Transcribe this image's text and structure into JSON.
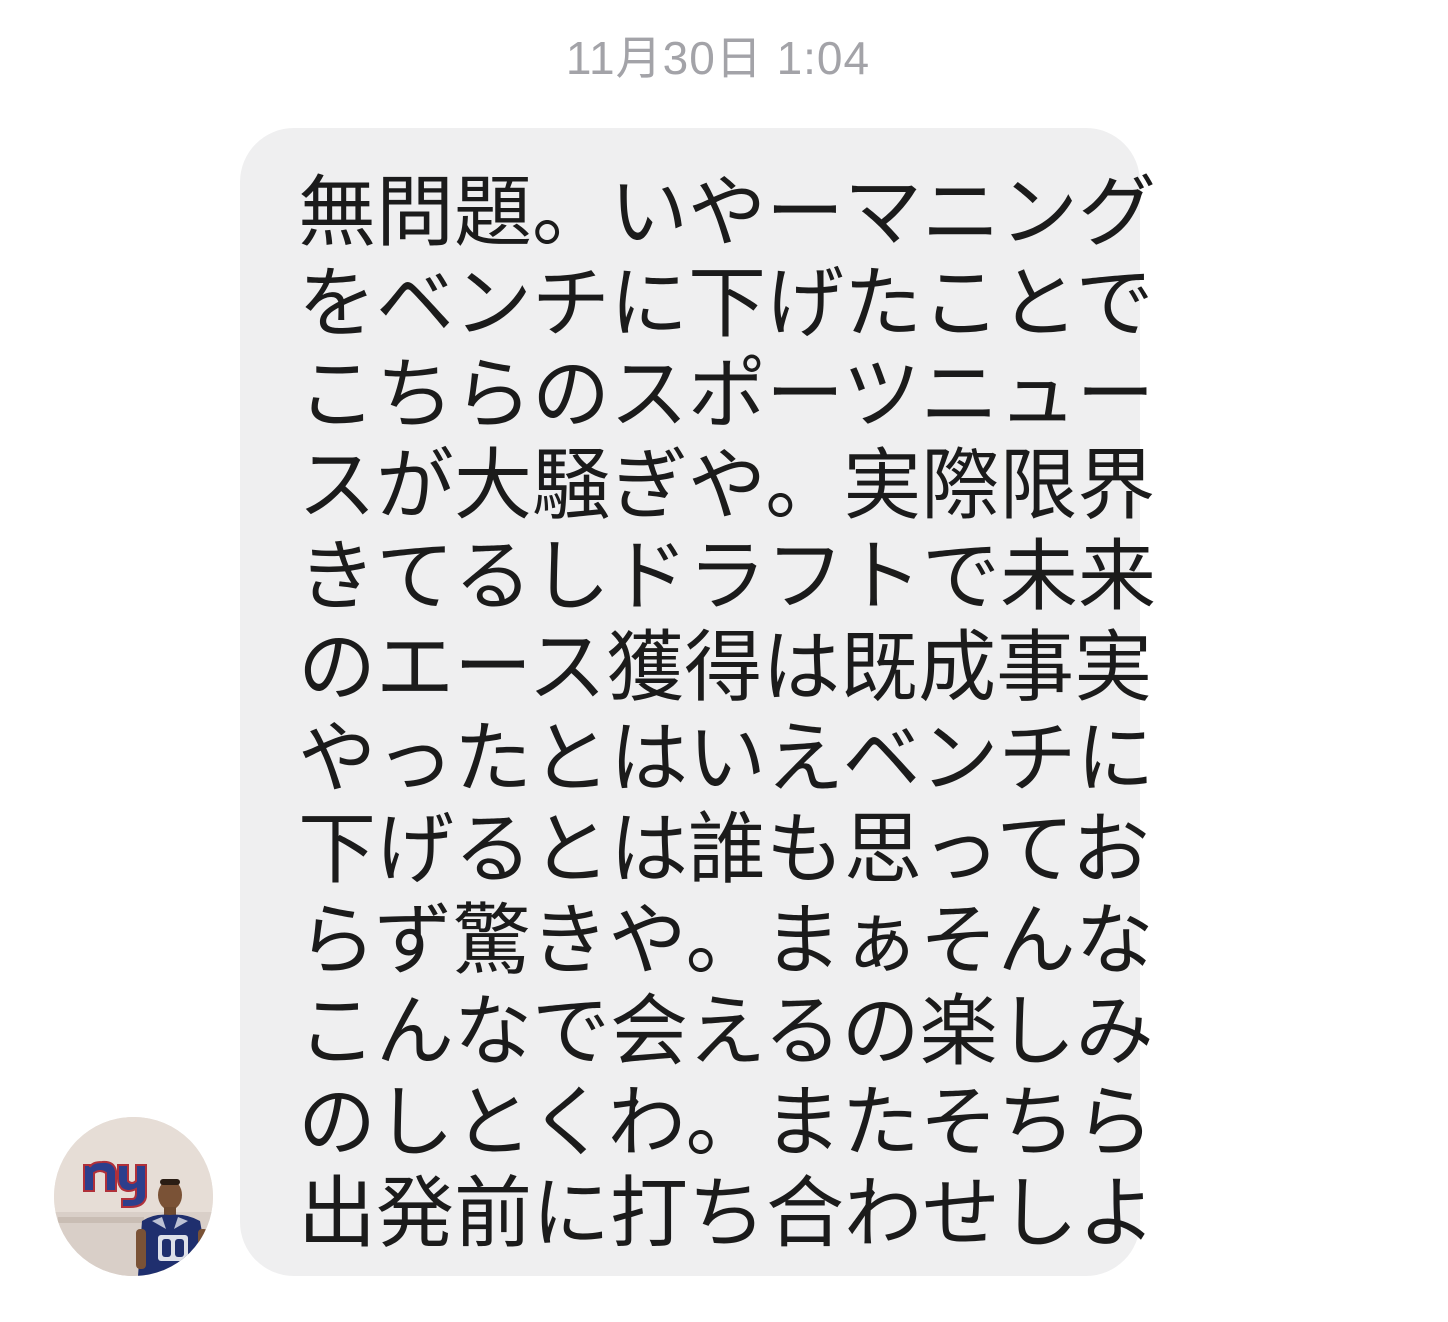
{
  "conversation": {
    "timestamp": "11月30日 1:04"
  },
  "message": {
    "sender_avatar_icon": "avatar-ny-giants-photo",
    "lines": [
      "無問題。いやーマニング",
      "をベンチに下げたことで",
      "こちらのスポーツニュー",
      "スが大騒ぎや。実際限界",
      "きてるしドラフトで未来",
      "のエース獲得は既成事実",
      "やったとはいえベンチに",
      "下げるとは誰も思ってお",
      "らず驚きや。まぁそんな",
      "こんなで会えるの楽しみ",
      "のしとくわ。またそちら",
      "出発前に打ち合わせしよ"
    ]
  },
  "colors": {
    "bubble_bg": "#efeff0",
    "text": "#1b1b1b",
    "timestamp": "#a3a3a8",
    "logo_blue": "#2c3e8c",
    "logo_red": "#b0303a"
  }
}
